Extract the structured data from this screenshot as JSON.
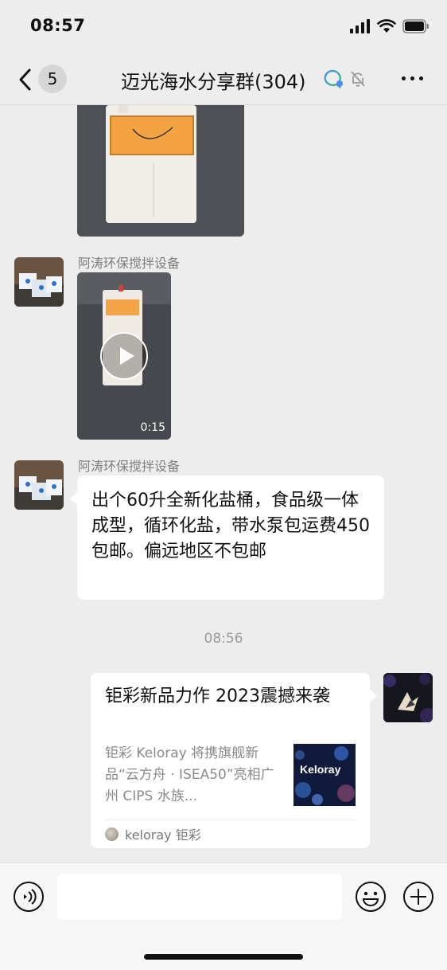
{
  "status_bar": {
    "time": "08:57"
  },
  "nav": {
    "back_count": "5",
    "title": "迈光海水分享群(304)"
  },
  "messages": {
    "sender_1": "阿涛环保搅拌设备",
    "video_duration": "0:15",
    "sender_2": "阿涛环保搅拌设备",
    "text_message": "出个60升全新化盐桶，食品级一体成型，循环化盐，带水泵包运费450包邮。偏远地区不包邮"
  },
  "timestamp": "08:56",
  "link_card": {
    "title": "钜彩新品力作 2023震撼来袭",
    "description": "钜彩 Keloray 将携旗舰新品“云方舟 · ISEA50”亮相广州 CIPS 水族...",
    "thumbnail_text": "Keloray",
    "source": "keloray 钜彩"
  },
  "input": {
    "placeholder": ""
  },
  "colors": {
    "accent_blue": "#4a8cf7",
    "accent_green": "#3fbf6f",
    "bubble_bg": "#ffffff",
    "chat_bg": "#ededed"
  }
}
